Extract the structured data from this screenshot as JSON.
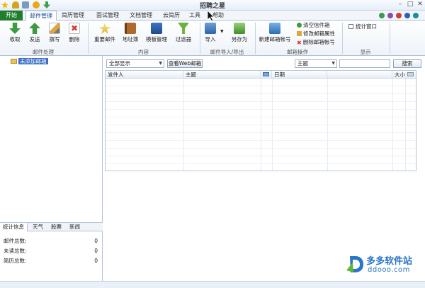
{
  "app": {
    "title": "招聘之星"
  },
  "start_button": "开始",
  "tabs": [
    {
      "label": "邮件管理",
      "active": true
    },
    {
      "label": "简历管理"
    },
    {
      "label": "面试管理"
    },
    {
      "label": "文档管理"
    },
    {
      "label": "云简历"
    },
    {
      "label": "工具"
    },
    {
      "label": "帮助"
    }
  ],
  "ribbon": {
    "groups": {
      "mail": "邮件处理",
      "content": "内容",
      "import_export": "邮件导入/导出",
      "mailbox_ops": "邮箱操作",
      "display": "显示"
    },
    "buttons": {
      "receive": "收取",
      "send": "发送",
      "compose": "撰写",
      "delete": "删除",
      "important": "重要邮件",
      "addressbook": "地址簿",
      "template": "模板管理",
      "filter": "过滤器",
      "import": "导入",
      "save_as": "另存为",
      "new_account": "新建邮箱帐号",
      "clear_folder": "清空信件箱",
      "edit_props": "修改邮箱属性",
      "delete_account": "删除邮箱帐号",
      "stats_window": "统计窗口"
    }
  },
  "tree": {
    "root_label": "未添加邮箱"
  },
  "filters": {
    "display_value": "全部显示",
    "web_mail_button": "查看Web邮箱",
    "field_value": "主题",
    "search_value": "",
    "search_button": "搜索"
  },
  "mail_table": {
    "columns": [
      "发件人",
      "主题",
      "",
      "日期",
      "",
      "大小",
      ""
    ]
  },
  "stats": {
    "tabs": [
      "统计信息",
      "天气",
      "股票",
      "新闻"
    ],
    "rows": [
      {
        "label": "邮件总数:",
        "value": "0"
      },
      {
        "label": "未读总数:",
        "value": "0"
      },
      {
        "label": "简历总数:",
        "value": "0"
      }
    ]
  },
  "watermark": {
    "brand": "多多软件站",
    "domain": "ddooo.com"
  }
}
